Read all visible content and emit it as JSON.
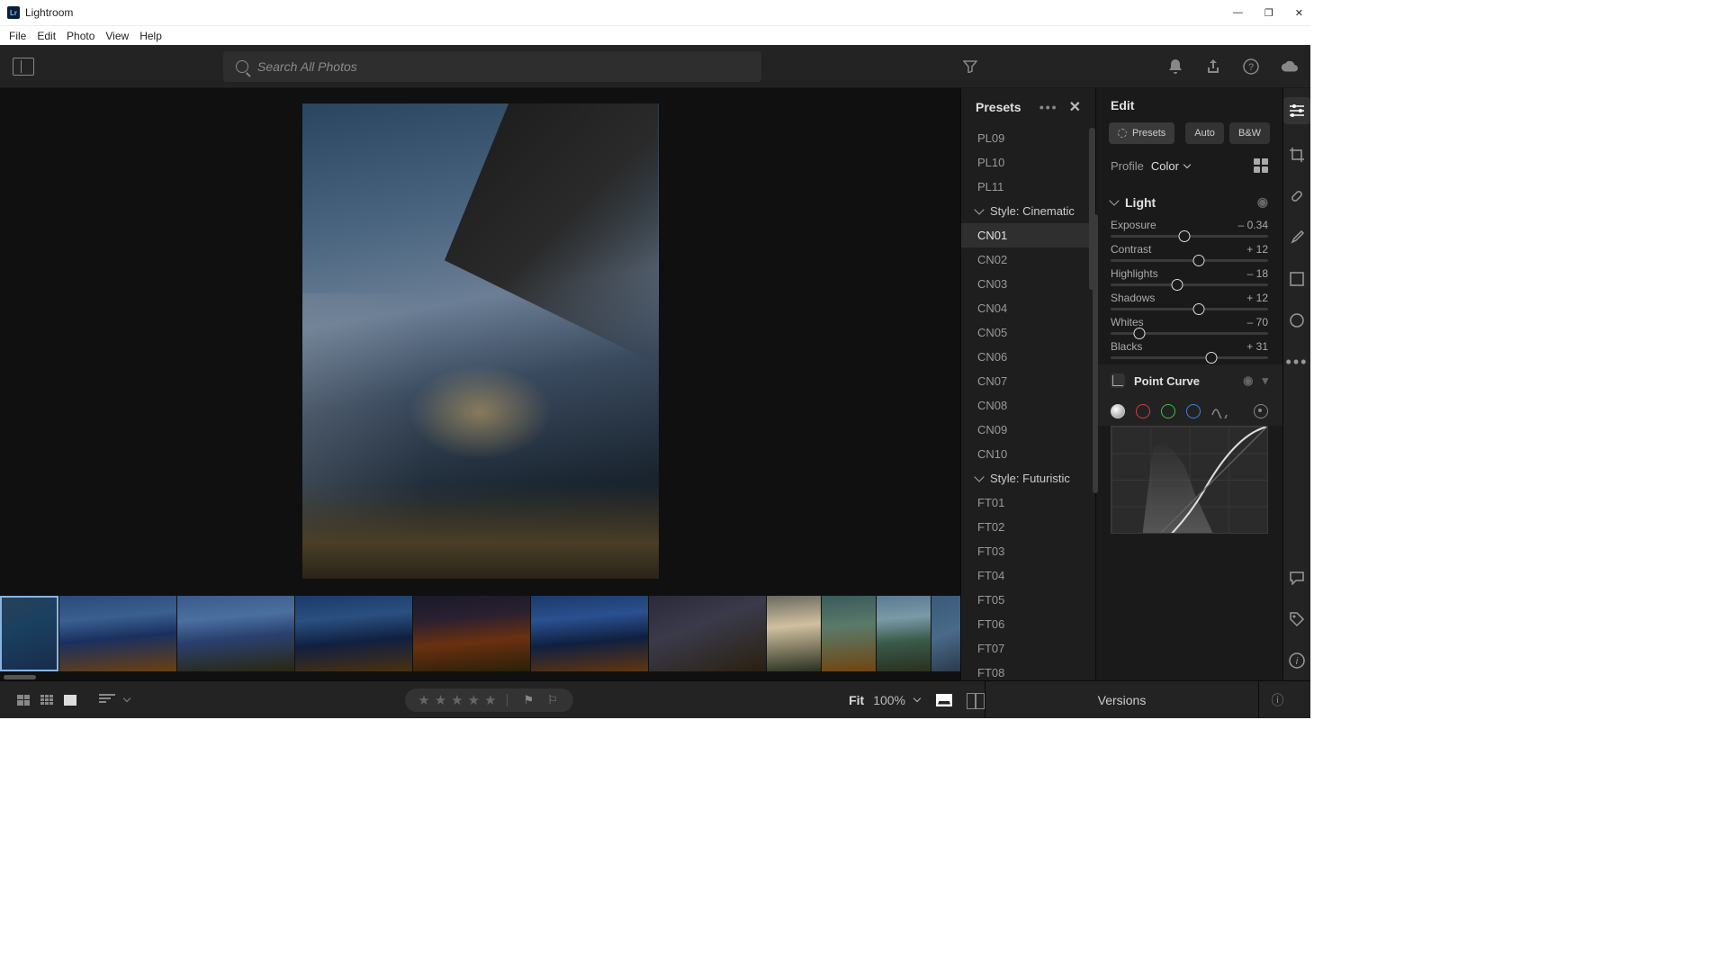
{
  "app": {
    "title": "Lightroom",
    "logo_text": "Lr"
  },
  "menu": [
    "File",
    "Edit",
    "Photo",
    "View",
    "Help"
  ],
  "toolbar": {
    "search_placeholder": "Search All Photos"
  },
  "presets_panel": {
    "title": "Presets",
    "items_before": [
      "PL09",
      "PL10",
      "PL11"
    ],
    "group1": "Style: Cinematic",
    "group1_items": [
      "CN01",
      "CN02",
      "CN03",
      "CN04",
      "CN05",
      "CN06",
      "CN07",
      "CN08",
      "CN09",
      "CN10"
    ],
    "selected": "CN01",
    "group2": "Style: Futuristic",
    "group2_items": [
      "FT01",
      "FT02",
      "FT03",
      "FT04",
      "FT05",
      "FT06",
      "FT07",
      "FT08"
    ]
  },
  "edit_panel": {
    "title": "Edit",
    "presets_btn": "Presets",
    "auto_btn": "Auto",
    "bw_btn": "B&W",
    "profile_label": "Profile",
    "profile_value": "Color",
    "light_section": "Light",
    "sliders": {
      "exposure": {
        "label": "Exposure",
        "value": "– 0.34",
        "pos": 47
      },
      "contrast": {
        "label": "Contrast",
        "value": "+ 12",
        "pos": 56
      },
      "highlights": {
        "label": "Highlights",
        "value": "– 18",
        "pos": 42
      },
      "shadows": {
        "label": "Shadows",
        "value": "+ 12",
        "pos": 56
      },
      "whites": {
        "label": "Whites",
        "value": "– 70",
        "pos": 18
      },
      "blacks": {
        "label": "Blacks",
        "value": "+ 31",
        "pos": 64
      }
    },
    "point_curve": "Point Curve"
  },
  "bottom": {
    "fit_label": "Fit",
    "zoom": "100%",
    "versions": "Versions"
  },
  "win": {
    "min": "—",
    "max": "❐",
    "close": "✕"
  }
}
